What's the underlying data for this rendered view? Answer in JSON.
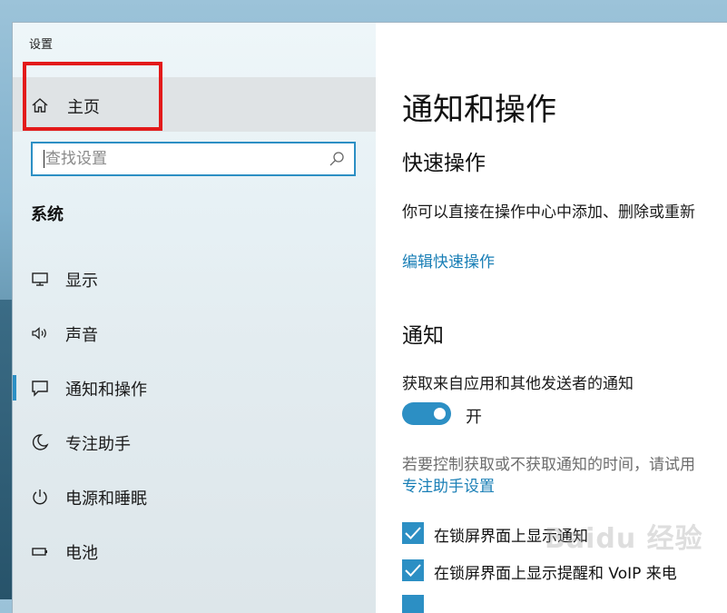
{
  "window": {
    "title": "设置"
  },
  "sidebar": {
    "home_label": "主页",
    "search_placeholder": "查找设置",
    "section_title": "系统",
    "items": [
      {
        "label": "显示",
        "icon": "monitor-icon"
      },
      {
        "label": "声音",
        "icon": "speaker-icon"
      },
      {
        "label": "通知和操作",
        "icon": "notification-icon",
        "selected": true
      },
      {
        "label": "专注助手",
        "icon": "moon-icon"
      },
      {
        "label": "电源和睡眠",
        "icon": "power-icon"
      },
      {
        "label": "电池",
        "icon": "battery-icon"
      }
    ]
  },
  "content": {
    "page_title": "通知和操作",
    "quick_actions": {
      "heading": "快速操作",
      "description": "你可以直接在操作中心中添加、删除或重新",
      "edit_link": "编辑快速操作"
    },
    "notifications": {
      "heading": "通知",
      "get_notifications_label": "获取来自应用和其他发送者的通知",
      "toggle_state_label": "开",
      "toggle_on": true,
      "focus_hint": "若要控制获取或不获取通知的时间，请试用",
      "focus_link": "专注助手设置",
      "checkboxes": [
        {
          "label": "在锁屏界面上显示通知",
          "checked": true
        },
        {
          "label": "在锁屏界面上显示提醒和 VoIP 来电",
          "checked": true
        }
      ]
    }
  },
  "watermark": "Baidu 经验",
  "colors": {
    "accent": "#2c8fc4",
    "highlight_box": "#e31a1a",
    "link": "#1a7fb6"
  }
}
